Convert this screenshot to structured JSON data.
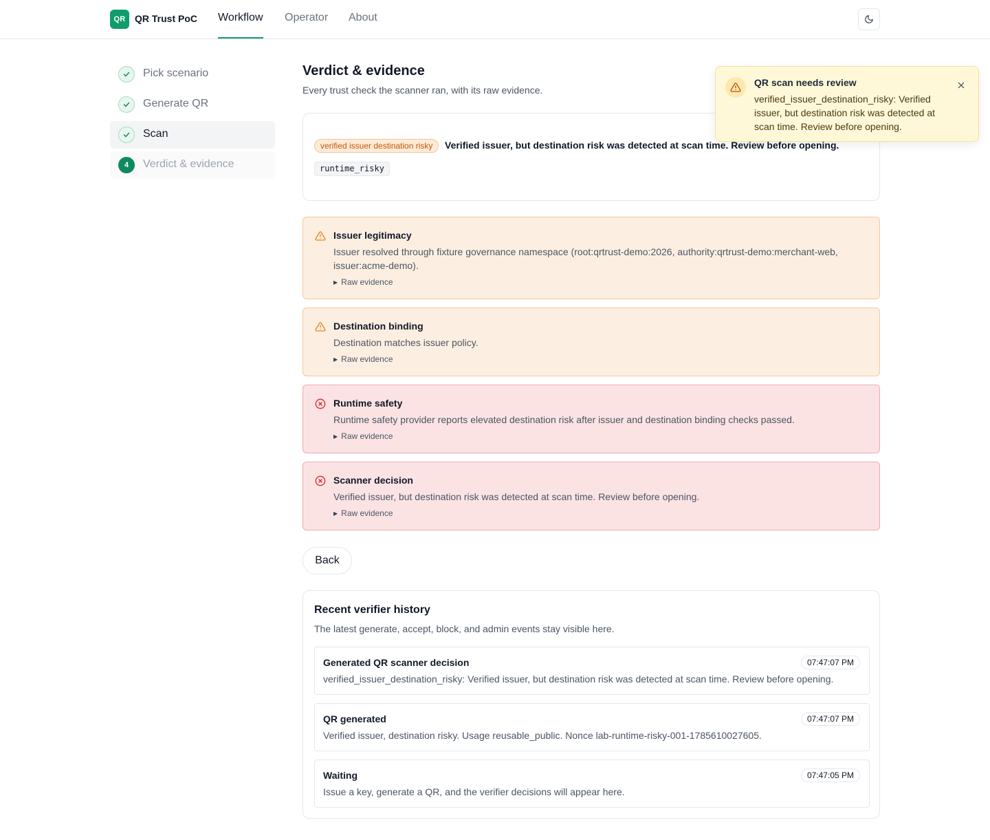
{
  "header": {
    "logo_text": "QR",
    "app_title": "QR Trust PoC",
    "tabs": [
      {
        "label": "Workflow",
        "active": true
      },
      {
        "label": "Operator",
        "active": false
      },
      {
        "label": "About",
        "active": false
      }
    ],
    "theme_icon": "moon-icon"
  },
  "stepper": {
    "steps": [
      {
        "label": "Pick scenario",
        "state": "done"
      },
      {
        "label": "Generate QR",
        "state": "done"
      },
      {
        "label": "Scan",
        "state": "current"
      },
      {
        "label": "Verdict & evidence",
        "state": "pending",
        "number": "4"
      }
    ]
  },
  "main": {
    "title": "Verdict & evidence",
    "subtitle": "Every trust check the scanner ran, with its raw evidence.",
    "verdict": {
      "badge": "verified issuer destination risky",
      "text": "Verified issuer, but destination risk was detected at scan time. Review before opening.",
      "code": "runtime_risky"
    },
    "checks": [
      {
        "title": "Issuer legitimacy",
        "status": "warning",
        "icon": "warning-triangle-icon",
        "description": "Issuer resolved through fixture governance namespace (root:qrtrust-demo:2026, authority:qrtrust-demo:merchant-web, issuer:acme-demo).",
        "raw_label": "Raw evidence"
      },
      {
        "title": "Destination binding",
        "status": "warning",
        "icon": "warning-triangle-icon",
        "description": "Destination matches issuer policy.",
        "raw_label": "Raw evidence"
      },
      {
        "title": "Runtime safety",
        "status": "fail",
        "icon": "x-circle-icon",
        "description": "Runtime safety provider reports elevated destination risk after issuer and destination binding checks passed.",
        "raw_label": "Raw evidence"
      },
      {
        "title": "Scanner decision",
        "status": "fail",
        "icon": "x-circle-icon",
        "description": "Verified issuer, but destination risk was detected at scan time. Review before opening.",
        "raw_label": "Raw evidence"
      }
    ],
    "back_label": "Back"
  },
  "history": {
    "title": "Recent verifier history",
    "subtitle": "The latest generate, accept, block, and admin events stay visible here.",
    "items": [
      {
        "title": "Generated QR scanner decision",
        "time": "07:47:07 PM",
        "text": "verified_issuer_destination_risky: Verified issuer, but destination risk was detected at scan time. Review before opening."
      },
      {
        "title": "QR generated",
        "time": "07:47:07 PM",
        "text": "Verified issuer, destination risky. Usage reusable_public. Nonce lab-runtime-risky-001-1785610027605."
      },
      {
        "title": "Waiting",
        "time": "07:47:05 PM",
        "text": "Issue a key, generate a QR, and the verifier decisions will appear here."
      }
    ]
  },
  "toast": {
    "title": "QR scan needs review",
    "text": "verified_issuer_destination_risky: Verified issuer, but destination risk was detected at scan time. Review before opening.",
    "icon": "warning-triangle-icon"
  },
  "colors": {
    "brand": "#0f9d6b",
    "warning_bg": "#fcefe2",
    "fail_bg": "#fbe3e4",
    "toast_bg": "#fef8d8"
  }
}
